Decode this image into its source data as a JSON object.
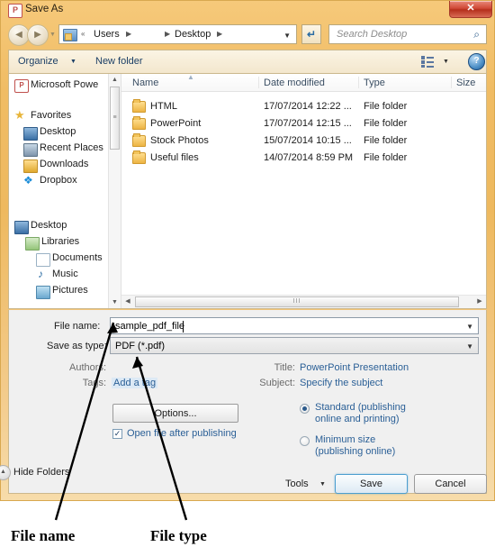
{
  "window": {
    "title": "Save As",
    "app_icon": "powerpoint-icon",
    "app_icon_letter": "P",
    "close_label": "✕"
  },
  "nav": {
    "back_icon": "◀",
    "forward_icon": "▶",
    "breadcrumb": {
      "chevrons": "«",
      "items": [
        "Users",
        "Desktop"
      ],
      "sep": "▶"
    },
    "dropdown_icon": "▼",
    "refresh_icon": "↵",
    "search": {
      "placeholder": "Search Desktop",
      "icon": "⌕"
    }
  },
  "toolbar": {
    "organize": "Organize",
    "organize_caret": "▼",
    "new_folder": "New folder",
    "view_caret": "▼",
    "help_label": "?"
  },
  "sidebar": {
    "scroll_up": "▲",
    "scroll_down": "▼",
    "thumb_grip": "≡",
    "items": [
      {
        "label": "Microsoft Powe",
        "icon": "powerpoint-icon",
        "indent": 0
      },
      {
        "label": "Favorites",
        "icon": "star-icon",
        "indent": 0
      },
      {
        "label": "Desktop",
        "icon": "monitor-icon",
        "indent": 1
      },
      {
        "label": "Recent Places",
        "icon": "recent-icon",
        "indent": 1
      },
      {
        "label": "Downloads",
        "icon": "downloads-icon",
        "indent": 1
      },
      {
        "label": "Dropbox",
        "icon": "dropbox-icon",
        "indent": 1
      },
      {
        "label": "Desktop",
        "icon": "monitor-icon",
        "indent": 0
      },
      {
        "label": "Libraries",
        "icon": "libraries-icon",
        "indent": 1
      },
      {
        "label": "Documents",
        "icon": "documents-icon",
        "indent": 2
      },
      {
        "label": "Music",
        "icon": "music-icon",
        "indent": 2
      },
      {
        "label": "Pictures",
        "icon": "pictures-icon",
        "indent": 2
      }
    ]
  },
  "filelist": {
    "columns": [
      "Name",
      "Date modified",
      "Type",
      "Size"
    ],
    "sort_indicator": "▲",
    "rows": [
      {
        "name": "HTML",
        "date": "17/07/2014 12:22 ...",
        "type": "File folder",
        "size": ""
      },
      {
        "name": "PowerPoint",
        "date": "17/07/2014 12:15 ...",
        "type": "File folder",
        "size": ""
      },
      {
        "name": "Stock Photos",
        "date": "15/07/2014 10:15 ...",
        "type": "File folder",
        "size": ""
      },
      {
        "name": "Useful files",
        "date": "14/07/2014 8:59 PM",
        "type": "File folder",
        "size": ""
      }
    ],
    "hscroll": {
      "left": "◀",
      "right": "▶",
      "grip": "III"
    }
  },
  "form": {
    "filename_label": "File name:",
    "filename_value": "sample_pdf_file",
    "savetype_label": "Save as type:",
    "savetype_value": "PDF (*.pdf)",
    "dropdown_icon": "▼",
    "authors_label": "Authors:",
    "authors_value": "",
    "tags_label": "Tags:",
    "tags_value": "Add a tag",
    "title_label": "Title:",
    "title_value": "PowerPoint Presentation",
    "subject_label": "Subject:",
    "subject_value": "Specify the subject",
    "options_button": "Options...",
    "open_after_publish": "Open file after publishing",
    "open_after_publish_checked": true,
    "check_glyph": "✓",
    "optimize": [
      {
        "line1": "Standard (publishing",
        "line2": "online and printing)",
        "selected": true
      },
      {
        "line1": "Minimum size",
        "line2": "(publishing online)",
        "selected": false
      }
    ],
    "tools_label": "Tools",
    "tools_caret": "▼",
    "save_label": "Save",
    "cancel_label": "Cancel",
    "hide_folders_label": "Hide Folders",
    "hide_folders_icon": "▲"
  },
  "annotations": {
    "file_name": "File name",
    "file_type": "File type"
  },
  "colors": {
    "window_chrome": "#eeb95f",
    "link_blue": "#2a5f96",
    "close_red": "#b52f1c",
    "focus_blue": "#4c9ecf"
  }
}
